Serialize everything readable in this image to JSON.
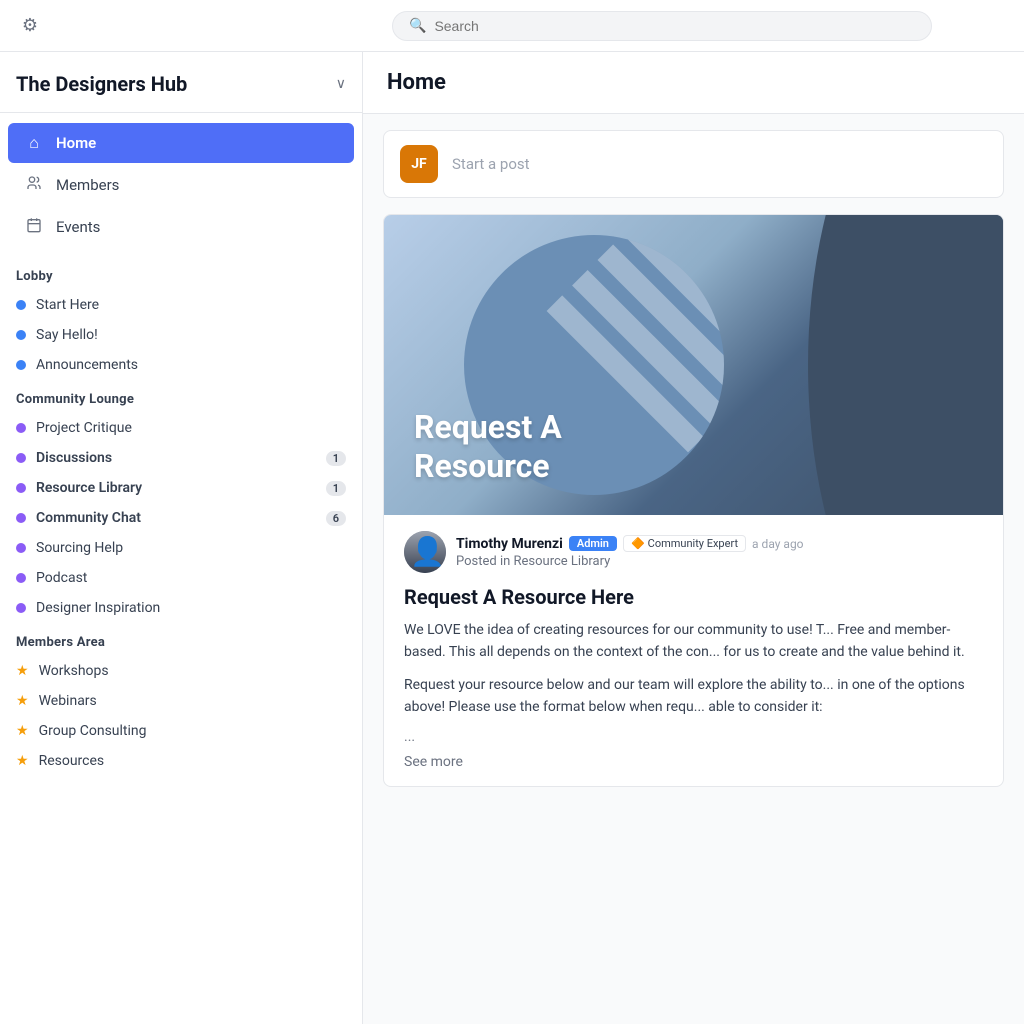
{
  "topbar": {
    "gear_label": "⚙",
    "search_placeholder": "Search"
  },
  "sidebar": {
    "title": "The Designers Hub",
    "chevron": "∨",
    "nav": [
      {
        "id": "home",
        "icon": "⌂",
        "label": "Home",
        "active": true
      },
      {
        "id": "members",
        "icon": "👥",
        "label": "Members",
        "active": false
      },
      {
        "id": "events",
        "icon": "📅",
        "label": "Events",
        "active": false
      }
    ],
    "lobby_label": "Lobby",
    "lobby_channels": [
      {
        "id": "start-here",
        "label": "Start Here",
        "dot": "blue",
        "bold": false
      },
      {
        "id": "say-hello",
        "label": "Say Hello!",
        "dot": "blue",
        "bold": false
      },
      {
        "id": "announcements",
        "label": "Announcements",
        "dot": "blue",
        "bold": false
      }
    ],
    "lounge_label": "Community Lounge",
    "lounge_channels": [
      {
        "id": "project-critique",
        "label": "Project Critique",
        "dot": "purple",
        "bold": false,
        "badge": null
      },
      {
        "id": "discussions",
        "label": "Discussions",
        "dot": "purple",
        "bold": true,
        "badge": "1"
      },
      {
        "id": "resource-library",
        "label": "Resource Library",
        "dot": "purple",
        "bold": true,
        "badge": "1"
      },
      {
        "id": "community-chat",
        "label": "Community Chat",
        "dot": "purple",
        "bold": true,
        "badge": "6"
      },
      {
        "id": "sourcing-help",
        "label": "Sourcing Help",
        "dot": "purple",
        "bold": false,
        "badge": null
      },
      {
        "id": "podcast",
        "label": "Podcast",
        "dot": "purple",
        "bold": false,
        "badge": null
      },
      {
        "id": "designer-inspiration",
        "label": "Designer Inspiration",
        "dot": "purple",
        "bold": false,
        "badge": null
      }
    ],
    "members_label": "Members Area",
    "members_channels": [
      {
        "id": "workshops",
        "label": "Workshops"
      },
      {
        "id": "webinars",
        "label": "Webinars"
      },
      {
        "id": "group-consulting",
        "label": "Group Consulting"
      },
      {
        "id": "resources",
        "label": "Resources"
      }
    ]
  },
  "content": {
    "page_title": "Home",
    "start_post_placeholder": "Start a post",
    "user_initials": "JF",
    "post": {
      "banner_text_line1": "Request A",
      "banner_text_line2": "Resource",
      "author_name": "Timothy Murenzi",
      "badge_admin": "Admin",
      "badge_expert": "Community Expert",
      "badge_expert_icon": "🔶",
      "time_ago": "a day ago",
      "posted_in": "Posted in Resource Library",
      "post_title": "Request A Resource Here",
      "body_p1": "We LOVE the idea of creating resources for our community to use! T... Free and member-based. This all depends on the context of the con... for us to create and the value behind it.",
      "body_p2": "Request your resource below and our team will explore the ability to... in one of the options above! Please use the format below when requ... able to consider it:",
      "ellipsis": "...",
      "see_more": "See more"
    }
  }
}
